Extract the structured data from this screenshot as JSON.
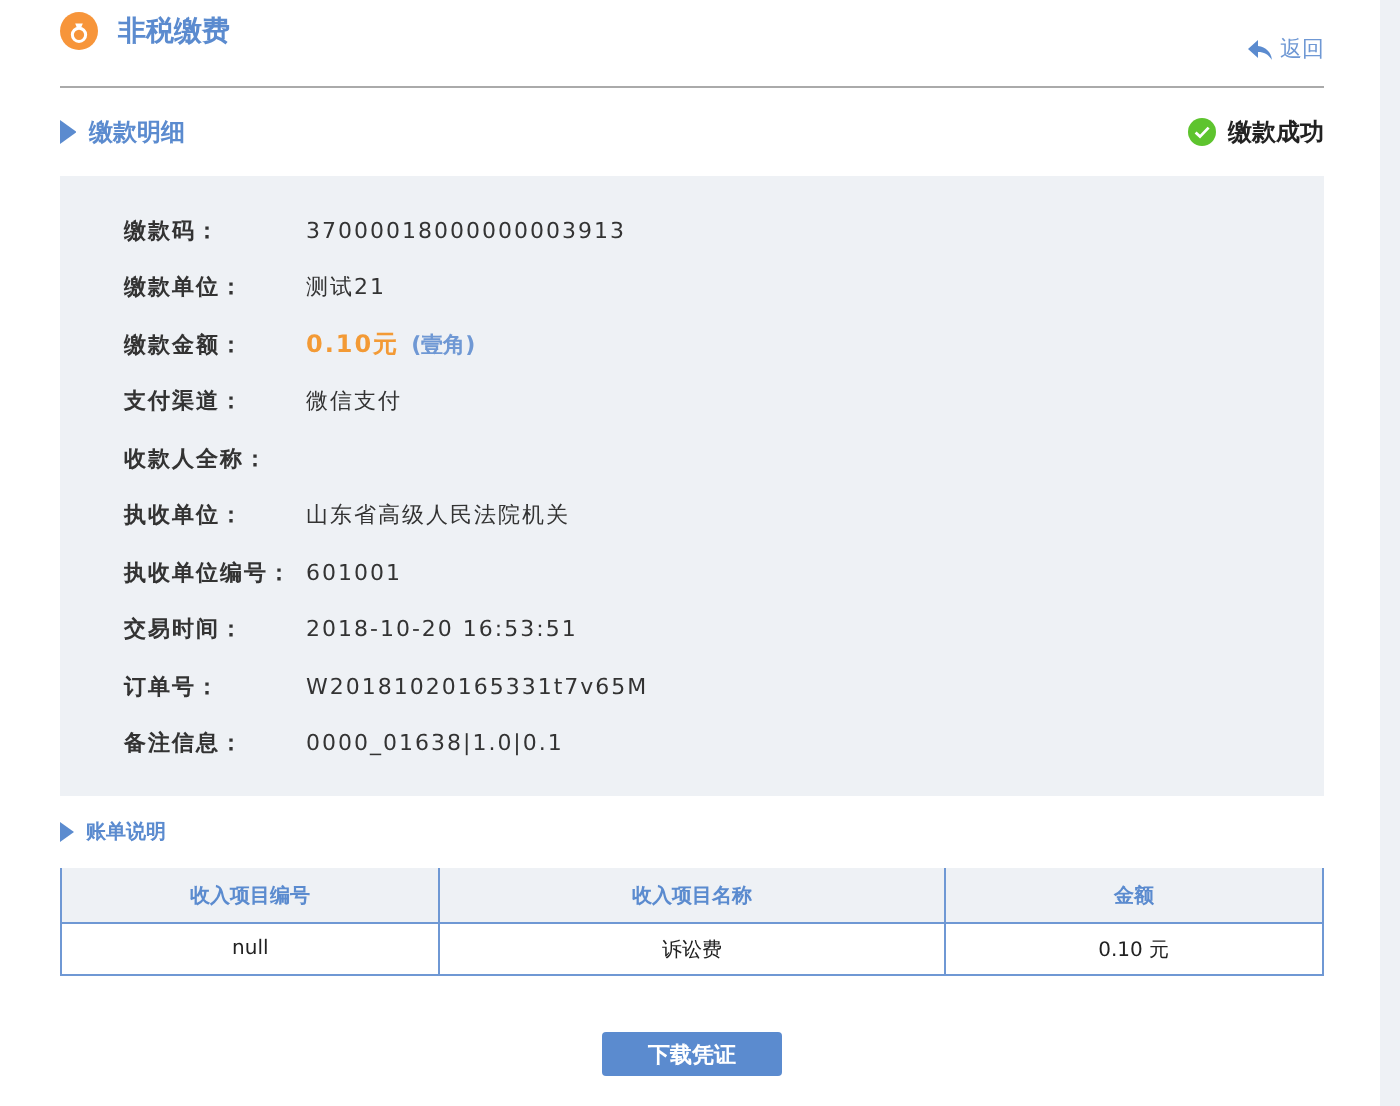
{
  "header": {
    "title": "非税缴费",
    "back_link": "返回"
  },
  "detail": {
    "title": "缴款明细",
    "status": "缴款成功",
    "rows": [
      {
        "label": "缴款码：",
        "value": "37000018000000003913",
        "kind": "plain"
      },
      {
        "label": "缴款单位：",
        "value": "测试21",
        "kind": "plain"
      },
      {
        "label": "缴款金额：",
        "value": "0.10元",
        "value_words": "(壹角)",
        "kind": "amount"
      },
      {
        "label": "支付渠道：",
        "value": "微信支付",
        "kind": "plain"
      },
      {
        "label": "收款人全称：",
        "kind": "plain"
      },
      {
        "label": "执收单位：",
        "value": "山东省高级人民法院机关",
        "kind": "plain"
      },
      {
        "label": "执收单位编号：",
        "value": "601001",
        "kind": "plain"
      },
      {
        "label": "交易时间：",
        "value": "2018-10-20 16:53:51",
        "kind": "plain"
      },
      {
        "label": "订单号：",
        "value": "W20181020165331t7v65M",
        "kind": "plain"
      },
      {
        "label": "备注信息：",
        "value": "0000_01638|1.0|0.1",
        "kind": "plain"
      }
    ]
  },
  "bill": {
    "title": "账单说明",
    "table": {
      "columns": [
        "收入项目编号",
        "收入项目名称",
        "金额"
      ],
      "rows": [
        [
          "null",
          "诉讼费",
          "0.10 元"
        ]
      ]
    }
  },
  "download_button": "下载凭证"
}
